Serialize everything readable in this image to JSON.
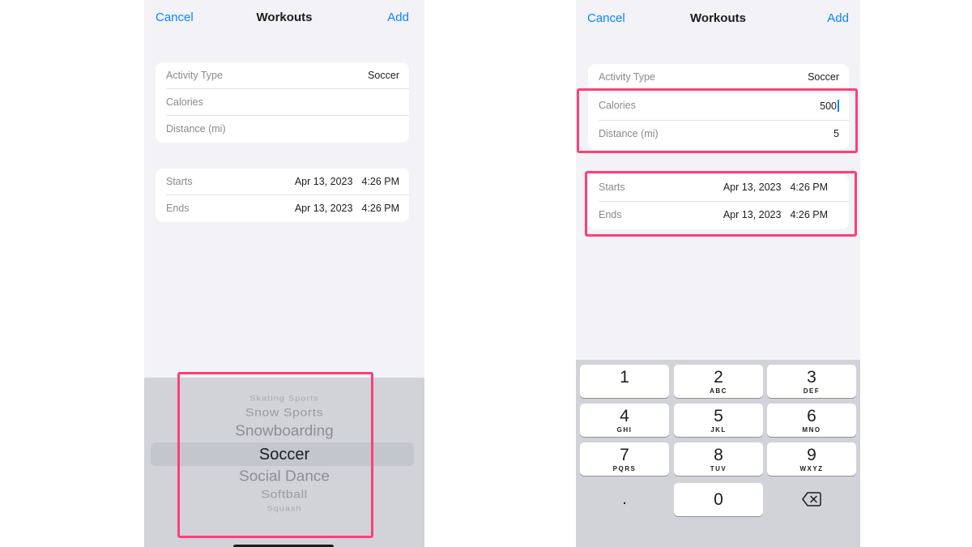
{
  "left": {
    "nav": {
      "cancel": "Cancel",
      "title": "Workouts",
      "add": "Add"
    },
    "details": [
      {
        "label": "Activity Type",
        "value": "Soccer"
      },
      {
        "label": "Calories",
        "value": ""
      },
      {
        "label": "Distance (mi)",
        "value": ""
      }
    ],
    "times": [
      {
        "label": "Starts",
        "date": "Apr 13, 2023",
        "time": "4:26 PM"
      },
      {
        "label": "Ends",
        "date": "Apr 13, 2023",
        "time": "4:26 PM"
      }
    ],
    "picker": {
      "items": [
        "Skating Sports",
        "Snow Sports",
        "Snowboarding",
        "Soccer",
        "Social Dance",
        "Softball",
        "Squash"
      ],
      "selected": "Soccer"
    }
  },
  "right": {
    "nav": {
      "cancel": "Cancel",
      "title": "Workouts",
      "add": "Add"
    },
    "details": [
      {
        "label": "Activity Type",
        "value": "Soccer"
      },
      {
        "label": "Calories",
        "value": "500"
      },
      {
        "label": "Distance (mi)",
        "value": "5"
      }
    ],
    "times": [
      {
        "label": "Starts",
        "date": "Apr 13, 2023",
        "time": "4:26 PM"
      },
      {
        "label": "Ends",
        "date": "Apr 13, 2023",
        "time": "4:26 PM"
      }
    ],
    "keypad": [
      {
        "num": "1",
        "letters": ""
      },
      {
        "num": "2",
        "letters": "ABC"
      },
      {
        "num": "3",
        "letters": "DEF"
      },
      {
        "num": "4",
        "letters": "GHI"
      },
      {
        "num": "5",
        "letters": "JKL"
      },
      {
        "num": "6",
        "letters": "MNO"
      },
      {
        "num": "7",
        "letters": "PQRS"
      },
      {
        "num": "8",
        "letters": "TUV"
      },
      {
        "num": "9",
        "letters": "WXYZ"
      },
      {
        "num": ".",
        "letters": ""
      },
      {
        "num": "0",
        "letters": ""
      },
      {
        "num": "",
        "letters": "",
        "icon": "backspace-icon"
      }
    ]
  },
  "colors": {
    "accent": "#0a84ff",
    "highlight": "#ff3f77",
    "background": "#f2f2f7",
    "keyboard": "#d1d3d9"
  }
}
